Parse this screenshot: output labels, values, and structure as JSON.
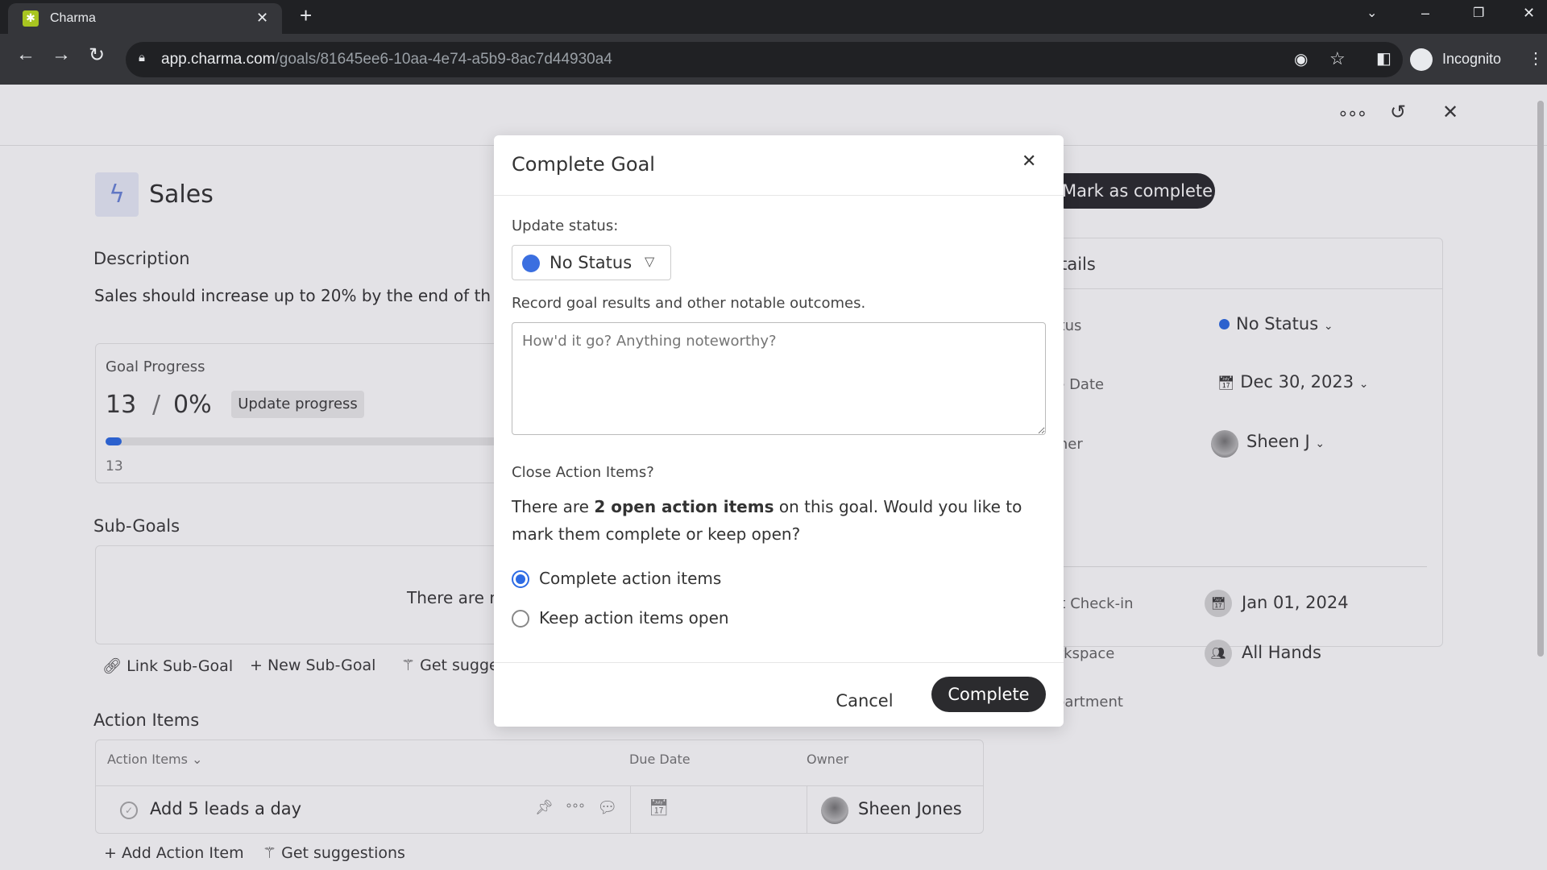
{
  "browser": {
    "tab_title": "Charma",
    "url_host": "app.charma.com",
    "url_path": "/goals/81645ee6-10aa-4e74-a5b9-8ac7d44930a4",
    "profile": "Incognito"
  },
  "goal": {
    "title": "Sales",
    "description_label": "Description",
    "description": "Sales should increase up to 20% by the end of th",
    "progress": {
      "label": "Goal Progress",
      "current": "13",
      "separator": "/",
      "percent": "0%",
      "percent_value": 0,
      "update_label": "Update progress",
      "bar_label": "13"
    },
    "subgoals": {
      "label": "Sub-Goals",
      "empty_text": "There are no",
      "link_label": "Link Sub-Goal",
      "new_label": "New Sub-Goal",
      "suggest_label": "Get suggestions"
    },
    "action_items": {
      "label": "Action Items",
      "columns": [
        "Action Items",
        "Due Date",
        "Owner"
      ],
      "rows": [
        {
          "title": "Add 5 leads a day",
          "due": "",
          "owner": "Sheen Jones"
        }
      ],
      "add_label": "Add Action Item",
      "suggest_label": "Get suggestions"
    }
  },
  "header": {
    "mark_complete_label": "Mark as complete"
  },
  "details": {
    "title": "Details",
    "rows": [
      {
        "label": "Status",
        "value": "No Status"
      },
      {
        "label": "Due Date",
        "value": "Dec 30, 2023"
      },
      {
        "label": "Owner",
        "value": "Sheen J"
      },
      {
        "label": "Last Check-in",
        "value": "Jan 01, 2024"
      },
      {
        "label": "Workspace",
        "value": "All Hands"
      },
      {
        "label": "Department",
        "value": ""
      }
    ],
    "status_color": "#2d6be4"
  },
  "modal": {
    "title": "Complete Goal",
    "update_status_label": "Update status:",
    "status_value": "No Status",
    "status_color": "#3b6fe0",
    "results_label": "Record goal results and other notable outcomes.",
    "results_placeholder": "How'd it go? Anything noteworthy?",
    "close_label": "Close Action Items?",
    "close_text_pre": "There are ",
    "close_text_bold": "2 open action items",
    "close_text_post": " on this goal. Would you like to mark them complete or keep open?",
    "options": [
      {
        "label": "Complete action items",
        "selected": true
      },
      {
        "label": "Keep action items open",
        "selected": false
      }
    ],
    "cancel_label": "Cancel",
    "complete_label": "Complete"
  }
}
